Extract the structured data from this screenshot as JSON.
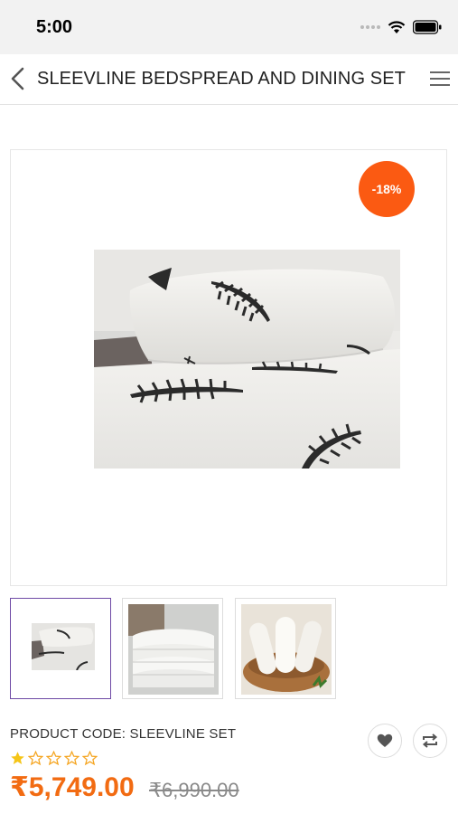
{
  "status_bar": {
    "time": "5:00"
  },
  "header": {
    "title": "SLEEVLINE BEDSPREAD AND DINING SET"
  },
  "product": {
    "discount_badge": "-18%",
    "code_label": "PRODUCT CODE: SLEEVLINE SET",
    "rating": 1,
    "rating_max": 5,
    "price": "₹5,749.00",
    "original_price": "₹6,990.00"
  },
  "thumbnails": [
    {
      "name": "bedspread thumbnail",
      "selected": true
    },
    {
      "name": "white towels thumbnail",
      "selected": false
    },
    {
      "name": "cushion rolls basket thumbnail",
      "selected": false
    }
  ],
  "colors": {
    "accent": "#f26b12",
    "badge": "#fb5a12",
    "selected_border": "#6e4aa5",
    "star": "#f5c518"
  },
  "icons": [
    "back-arrow-icon",
    "menu-icon",
    "wifi-icon",
    "battery-icon",
    "heart-icon",
    "compare-icon",
    "star-icon"
  ]
}
